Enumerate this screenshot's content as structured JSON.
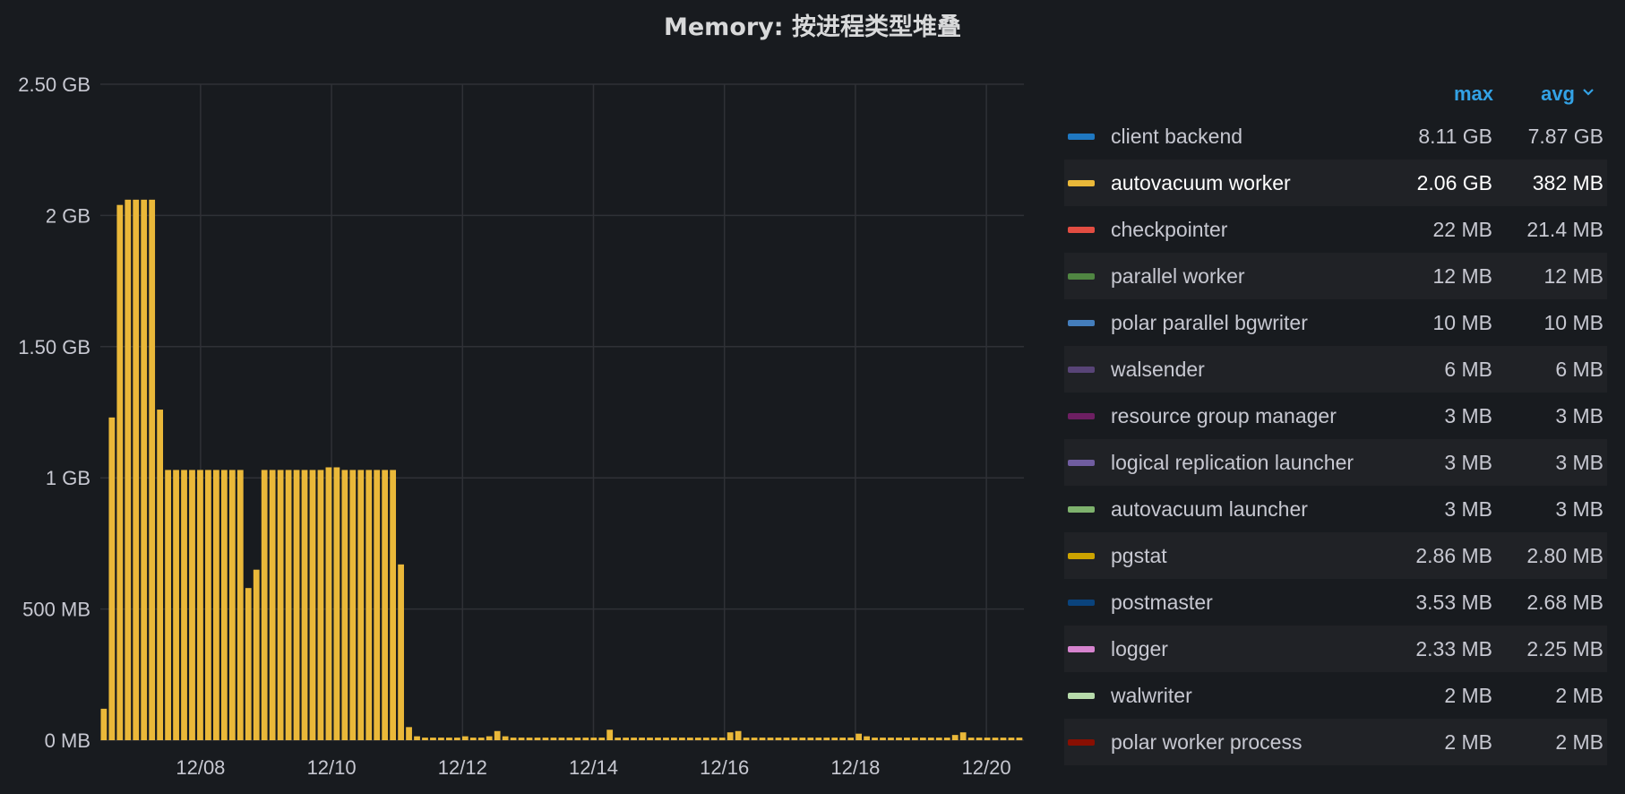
{
  "panel": {
    "title": "Memory: 按进程类型堆叠"
  },
  "legend": {
    "headers": {
      "max": "max",
      "avg": "avg"
    },
    "items": [
      {
        "name": "client backend",
        "max": "8.11 GB",
        "avg": "7.87 GB",
        "color": "#1f78c1"
      },
      {
        "name": "autovacuum worker",
        "max": "2.06 GB",
        "avg": "382 MB",
        "color": "#eab839"
      },
      {
        "name": "checkpointer",
        "max": "22 MB",
        "avg": "21.4 MB",
        "color": "#e24d42"
      },
      {
        "name": "parallel worker",
        "max": "12 MB",
        "avg": "12 MB",
        "color": "#508642"
      },
      {
        "name": "polar parallel bgwriter",
        "max": "10 MB",
        "avg": "10 MB",
        "color": "#447ebc"
      },
      {
        "name": "walsender",
        "max": "6 MB",
        "avg": "6 MB",
        "color": "#584477"
      },
      {
        "name": "resource group manager",
        "max": "3 MB",
        "avg": "3 MB",
        "color": "#6d1f62"
      },
      {
        "name": "logical replication launcher",
        "max": "3 MB",
        "avg": "3 MB",
        "color": "#705da0"
      },
      {
        "name": "autovacuum launcher",
        "max": "3 MB",
        "avg": "3 MB",
        "color": "#7eb26d"
      },
      {
        "name": "pgstat",
        "max": "2.86 MB",
        "avg": "2.80 MB",
        "color": "#cca300"
      },
      {
        "name": "postmaster",
        "max": "3.53 MB",
        "avg": "2.68 MB",
        "color": "#0a437c"
      },
      {
        "name": "logger",
        "max": "2.33 MB",
        "avg": "2.25 MB",
        "color": "#d683ce"
      },
      {
        "name": "walwriter",
        "max": "2 MB",
        "avg": "2 MB",
        "color": "#b7dbab"
      },
      {
        "name": "polar worker process",
        "max": "2 MB",
        "avg": "2 MB",
        "color": "#890f02"
      }
    ]
  },
  "chart_data": {
    "type": "bar",
    "series": [
      {
        "name": "autovacuum worker",
        "color": "#eab839",
        "values": [
          0.12,
          1.23,
          2.04,
          2.06,
          2.06,
          2.06,
          2.06,
          1.26,
          1.03,
          1.03,
          1.03,
          1.03,
          1.03,
          1.03,
          1.03,
          1.03,
          1.03,
          1.03,
          0.58,
          0.65,
          1.03,
          1.03,
          1.03,
          1.03,
          1.03,
          1.03,
          1.03,
          1.03,
          1.04,
          1.04,
          1.03,
          1.03,
          1.03,
          1.03,
          1.03,
          1.03,
          1.03,
          0.67,
          0.05,
          0.015,
          0.01,
          0.01,
          0.01,
          0.01,
          0.01,
          0.015,
          0.01,
          0.01,
          0.015,
          0.035,
          0.015,
          0.01,
          0.01,
          0.01,
          0.01,
          0.01,
          0.01,
          0.01,
          0.01,
          0.01,
          0.01,
          0.01,
          0.01,
          0.04,
          0.01,
          0.01,
          0.01,
          0.01,
          0.01,
          0.01,
          0.01,
          0.01,
          0.01,
          0.01,
          0.01,
          0.01,
          0.01,
          0.01,
          0.03,
          0.035,
          0.01,
          0.01,
          0.01,
          0.01,
          0.01,
          0.01,
          0.01,
          0.01,
          0.01,
          0.01,
          0.01,
          0.01,
          0.01,
          0.01,
          0.025,
          0.015,
          0.01,
          0.01,
          0.01,
          0.01,
          0.01,
          0.01,
          0.01,
          0.01,
          0.01,
          0.01,
          0.02,
          0.03,
          0.01,
          0.01,
          0.01,
          0.01,
          0.01,
          0.01,
          0.01
        ]
      }
    ],
    "x_start": "12/06",
    "x_ticks": [
      "12/08",
      "12/10",
      "12/12",
      "12/14",
      "12/16",
      "12/18",
      "12/20"
    ],
    "y_ticks": [
      "0 MB",
      "500 MB",
      "1 GB",
      "1.50 GB",
      "2 GB",
      "2.50 GB"
    ],
    "ylim": [
      0,
      2.5
    ],
    "ylabel": "",
    "xlabel": "",
    "grid": true,
    "legend_position": "right"
  }
}
